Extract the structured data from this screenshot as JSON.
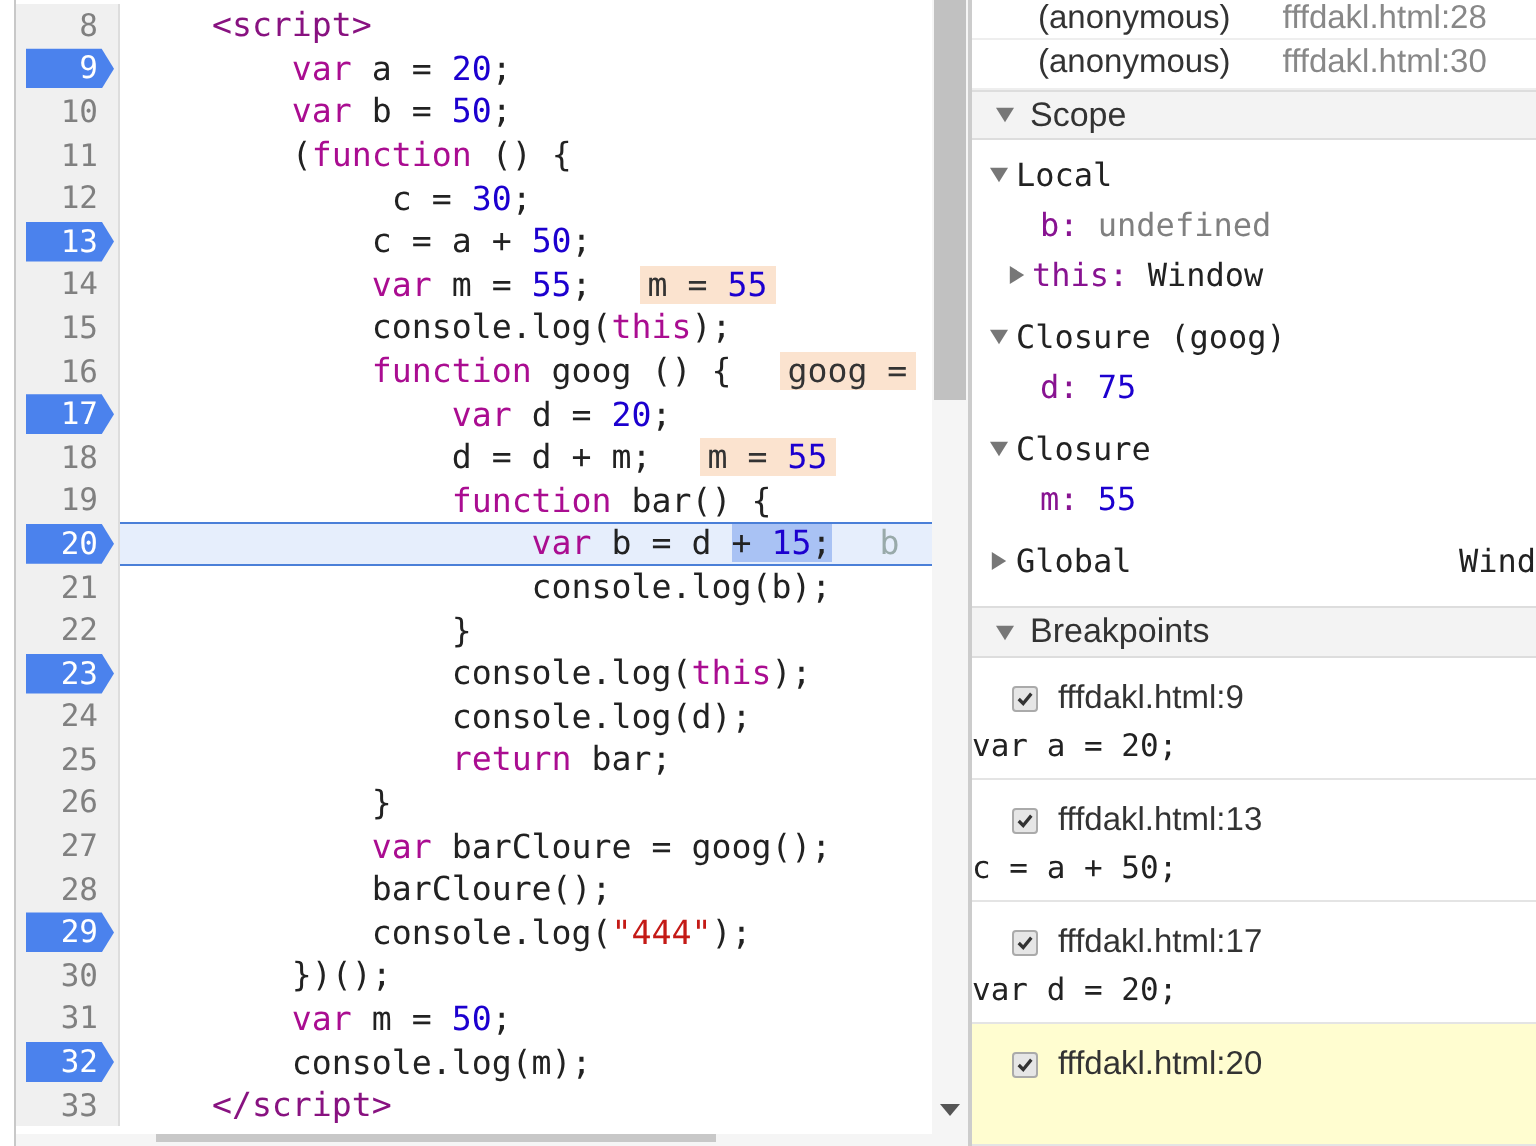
{
  "editor": {
    "lines": [
      {
        "number": "8",
        "breakpoint": false,
        "current": false,
        "tokens": [
          {
            "kind": "tag",
            "t": "    <script>"
          }
        ]
      },
      {
        "number": "9",
        "breakpoint": true,
        "current": false,
        "tokens": [
          {
            "kind": "kw",
            "t": "        var"
          },
          {
            "kind": "plain",
            "t": " a = "
          },
          {
            "kind": "num",
            "t": "20"
          },
          {
            "kind": "plain",
            "t": ";"
          }
        ]
      },
      {
        "number": "10",
        "breakpoint": false,
        "current": false,
        "tokens": [
          {
            "kind": "kw",
            "t": "        var"
          },
          {
            "kind": "plain",
            "t": " b = "
          },
          {
            "kind": "num",
            "t": "50"
          },
          {
            "kind": "plain",
            "t": ";"
          }
        ]
      },
      {
        "number": "11",
        "breakpoint": false,
        "current": false,
        "tokens": [
          {
            "kind": "plain",
            "t": "        ("
          },
          {
            "kind": "kw",
            "t": "function"
          },
          {
            "kind": "plain",
            "t": " () {"
          }
        ]
      },
      {
        "number": "12",
        "breakpoint": false,
        "current": false,
        "tokens": [
          {
            "kind": "plain",
            "t": "             c = "
          },
          {
            "kind": "num",
            "t": "30"
          },
          {
            "kind": "plain",
            "t": ";"
          }
        ]
      },
      {
        "number": "13",
        "breakpoint": true,
        "current": false,
        "tokens": [
          {
            "kind": "plain",
            "t": "            c = a + "
          },
          {
            "kind": "num",
            "t": "50"
          },
          {
            "kind": "plain",
            "t": ";"
          }
        ]
      },
      {
        "number": "14",
        "breakpoint": false,
        "current": false,
        "tokens": [
          {
            "kind": "kw",
            "t": "            var"
          },
          {
            "kind": "plain",
            "t": " m = "
          },
          {
            "kind": "num",
            "t": "55"
          },
          {
            "kind": "plain",
            "t": ";"
          }
        ],
        "inline_value": {
          "name": "m =",
          "value": "55"
        }
      },
      {
        "number": "15",
        "breakpoint": false,
        "current": false,
        "tokens": [
          {
            "kind": "plain",
            "t": "            console.log("
          },
          {
            "kind": "kw",
            "t": "this"
          },
          {
            "kind": "plain",
            "t": ");"
          }
        ]
      },
      {
        "number": "16",
        "breakpoint": false,
        "current": false,
        "tokens": [
          {
            "kind": "kw",
            "t": "            function"
          },
          {
            "kind": "plain",
            "t": " goog () {"
          }
        ],
        "inline_value": {
          "name": "goog ="
        }
      },
      {
        "number": "17",
        "breakpoint": true,
        "current": false,
        "tokens": [
          {
            "kind": "kw",
            "t": "                var"
          },
          {
            "kind": "plain",
            "t": " d = "
          },
          {
            "kind": "num",
            "t": "20"
          },
          {
            "kind": "plain",
            "t": ";"
          }
        ]
      },
      {
        "number": "18",
        "breakpoint": false,
        "current": false,
        "tokens": [
          {
            "kind": "plain",
            "t": "                d = d + m;"
          }
        ],
        "inline_value": {
          "name": "m =",
          "value": "55"
        }
      },
      {
        "number": "19",
        "breakpoint": false,
        "current": false,
        "tokens": [
          {
            "kind": "kw",
            "t": "                function"
          },
          {
            "kind": "plain",
            "t": " bar() {"
          }
        ]
      },
      {
        "number": "20",
        "breakpoint": true,
        "current": true,
        "tokens": [
          {
            "kind": "kw",
            "t": "                    var"
          },
          {
            "kind": "plain",
            "t": " b = d "
          },
          {
            "kind": "sel",
            "t": "+"
          },
          {
            "kind": "selnum",
            "t": " 15"
          },
          {
            "kind": "sel",
            "t": ";"
          }
        ],
        "hint": "b"
      },
      {
        "number": "21",
        "breakpoint": false,
        "current": false,
        "tokens": [
          {
            "kind": "plain",
            "t": "                    console.log(b);"
          }
        ]
      },
      {
        "number": "22",
        "breakpoint": false,
        "current": false,
        "tokens": [
          {
            "kind": "plain",
            "t": "                }"
          }
        ]
      },
      {
        "number": "23",
        "breakpoint": true,
        "current": false,
        "tokens": [
          {
            "kind": "plain",
            "t": "                console.log("
          },
          {
            "kind": "kw",
            "t": "this"
          },
          {
            "kind": "plain",
            "t": ");"
          }
        ]
      },
      {
        "number": "24",
        "breakpoint": false,
        "current": false,
        "tokens": [
          {
            "kind": "plain",
            "t": "                console.log(d);"
          }
        ]
      },
      {
        "number": "25",
        "breakpoint": false,
        "current": false,
        "tokens": [
          {
            "kind": "kw",
            "t": "                return"
          },
          {
            "kind": "plain",
            "t": " bar;"
          }
        ]
      },
      {
        "number": "26",
        "breakpoint": false,
        "current": false,
        "tokens": [
          {
            "kind": "plain",
            "t": "            }"
          }
        ]
      },
      {
        "number": "27",
        "breakpoint": false,
        "current": false,
        "tokens": [
          {
            "kind": "kw",
            "t": "            var"
          },
          {
            "kind": "plain",
            "t": " barCloure = goog();"
          }
        ]
      },
      {
        "number": "28",
        "breakpoint": false,
        "current": false,
        "tokens": [
          {
            "kind": "plain",
            "t": "            barCloure();"
          }
        ]
      },
      {
        "number": "29",
        "breakpoint": true,
        "current": false,
        "tokens": [
          {
            "kind": "plain",
            "t": "            console.log("
          },
          {
            "kind": "str",
            "t": "\"444\""
          },
          {
            "kind": "plain",
            "t": ");"
          }
        ]
      },
      {
        "number": "30",
        "breakpoint": false,
        "current": false,
        "tokens": [
          {
            "kind": "plain",
            "t": "        })();"
          }
        ]
      },
      {
        "number": "31",
        "breakpoint": false,
        "current": false,
        "tokens": [
          {
            "kind": "kw",
            "t": "        var"
          },
          {
            "kind": "plain",
            "t": " m = "
          },
          {
            "kind": "num",
            "t": "50"
          },
          {
            "kind": "plain",
            "t": ";"
          }
        ]
      },
      {
        "number": "32",
        "breakpoint": true,
        "current": false,
        "tokens": [
          {
            "kind": "plain",
            "t": "        console.log(m);"
          }
        ]
      },
      {
        "number": "33",
        "breakpoint": false,
        "current": false,
        "tokens": [
          {
            "kind": "tag",
            "t": "    </script>"
          }
        ]
      }
    ]
  },
  "call_stack": [
    {
      "function": "(anonymous)",
      "location": "fffdakl.html:28"
    },
    {
      "function": "(anonymous)",
      "location": "fffdakl.html:30"
    }
  ],
  "scope": {
    "title": "Scope",
    "expanded": true,
    "groups": [
      {
        "label": "Local",
        "expanded": true,
        "items": [
          {
            "name": "b:",
            "value": "undefined",
            "kind": "undefined",
            "expandable": false
          },
          {
            "name": "this:",
            "value": "Window",
            "kind": "object",
            "expandable": true
          }
        ]
      },
      {
        "label": "Closure (goog)",
        "expanded": true,
        "items": [
          {
            "name": "d:",
            "value": "75",
            "kind": "number",
            "expandable": false
          }
        ]
      },
      {
        "label": "Closure",
        "expanded": true,
        "items": [
          {
            "name": "m:",
            "value": "55",
            "kind": "number",
            "expandable": false
          }
        ]
      },
      {
        "label": "Global",
        "expanded": false,
        "value": "Wind"
      }
    ]
  },
  "breakpoints": {
    "title": "Breakpoints",
    "expanded": true,
    "items": [
      {
        "location": "fffdakl.html:9",
        "code": "var a = 20;",
        "checked": true,
        "selected": false
      },
      {
        "location": "fffdakl.html:13",
        "code": "c = a + 50;",
        "checked": true,
        "selected": false
      },
      {
        "location": "fffdakl.html:17",
        "code": "var d = 20;",
        "checked": true,
        "selected": false
      },
      {
        "location": "fffdakl.html:20",
        "checked": true,
        "selected": true
      }
    ]
  }
}
